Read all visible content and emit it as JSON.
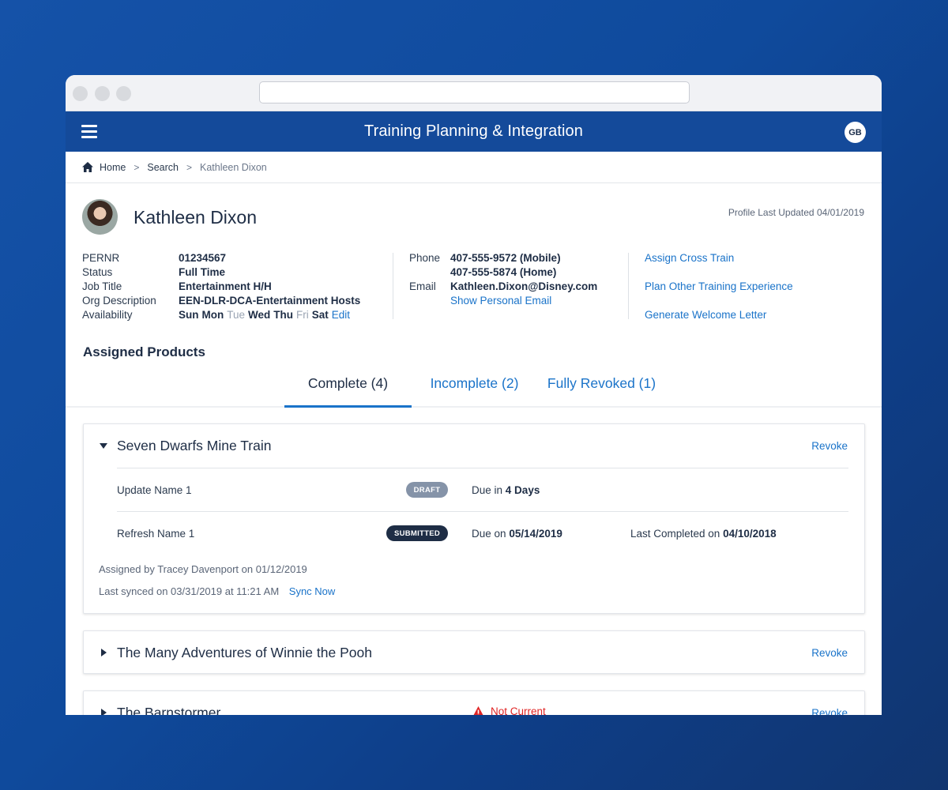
{
  "app": {
    "title": "Training Planning & Integration",
    "user_initials": "GB"
  },
  "breadcrumb": {
    "home": "Home",
    "search": "Search",
    "current": "Kathleen Dixon",
    "separator": ">"
  },
  "profile": {
    "name": "Kathleen Dixon",
    "last_updated": "Profile Last Updated 04/01/2019",
    "fields": {
      "pernr_label": "PERNR",
      "pernr": "01234567",
      "status_label": "Status",
      "status": "Full Time",
      "job_title_label": "Job Title",
      "job_title": "Entertainment H/H",
      "org_label": "Org Description",
      "org": "EEN-DLR-DCA-Entertainment Hosts",
      "availability_label": "Availability",
      "days": {
        "sun": "Sun",
        "mon": "Mon",
        "tue": "Tue",
        "wed": "Wed",
        "thu": "Thu",
        "fri": "Fri",
        "sat": "Sat"
      },
      "edit_label": "Edit"
    },
    "contact": {
      "phone_label": "Phone",
      "phone_mobile": "407-555-9572 (Mobile)",
      "phone_home": "407-555-5874 (Home)",
      "email_label": "Email",
      "email": "Kathleen.Dixon@Disney.com",
      "show_personal_email": "Show Personal Email"
    },
    "actions": {
      "assign_cross_train": "Assign Cross Train",
      "plan_other": "Plan Other Training Experience",
      "welcome_letter": "Generate Welcome Letter"
    }
  },
  "assigned": {
    "title": "Assigned Products",
    "tabs": {
      "complete": "Complete (4)",
      "incomplete": "Incomplete (2)",
      "revoked": "Fully Revoked (1)"
    }
  },
  "products": {
    "p1": {
      "title": "Seven Dwarfs Mine Train",
      "revoke": "Revoke",
      "c1": {
        "name": "Update Name 1",
        "badge": "DRAFT",
        "due_prefix": "Due in",
        "due_value": "4 Days"
      },
      "c2": {
        "name": "Refresh Name 1",
        "badge": "SUBMITTED",
        "due_prefix": "Due on",
        "due_value": "05/14/2019",
        "last_prefix": "Last Completed on",
        "last_value": "04/10/2018"
      },
      "assigned_by": "Assigned by Tracey Davenport on 01/12/2019",
      "last_synced": "Last synced on 03/31/2019 at 11:21 AM",
      "sync_now": "Sync Now"
    },
    "p2": {
      "title": "The Many Adventures of Winnie the Pooh",
      "revoke": "Revoke"
    },
    "p3": {
      "title": "The Barnstormer",
      "revoke": "Revoke",
      "warning": "Not Current"
    }
  },
  "colors": {
    "primary": "#144a9a",
    "link": "#1a73c9",
    "warning": "#e02424",
    "dark": "#1e2d45"
  }
}
